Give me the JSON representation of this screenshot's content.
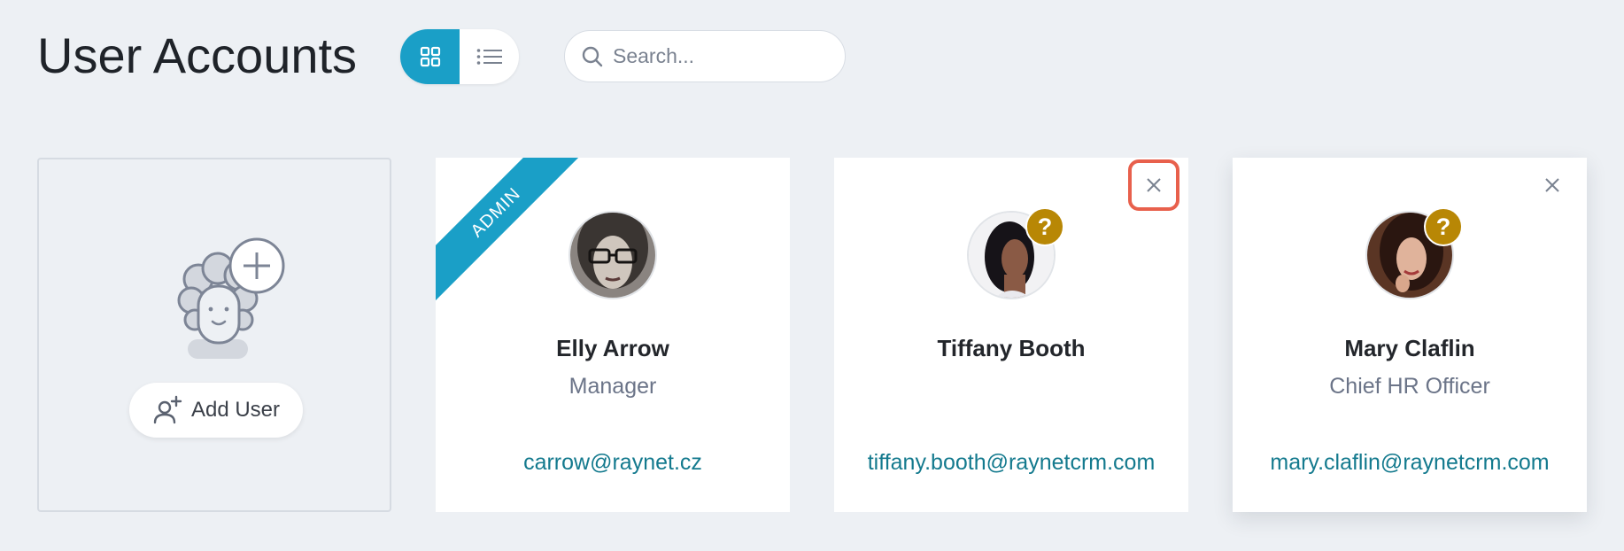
{
  "header": {
    "title": "User Accounts",
    "view_toggle": {
      "grid_icon": "grid-icon",
      "list_icon": "list-icon",
      "active": "grid"
    },
    "search": {
      "placeholder": "Search...",
      "value": "",
      "icon": "search-icon"
    }
  },
  "add_card": {
    "button_label": "Add User",
    "button_icon": "add-user-icon",
    "illustration": "add-user-illustration"
  },
  "users": [
    {
      "name": "Elly Arrow",
      "role": "Manager",
      "email": "carrow@raynet.cz",
      "badge": "ADMIN",
      "status_badge": "",
      "closable": false
    },
    {
      "name": "Tiffany Booth",
      "role": "",
      "email": "tiffany.booth@raynetcrm.com",
      "badge": "",
      "status_badge": "?",
      "closable": true,
      "close_highlighted": true
    },
    {
      "name": "Mary Claflin",
      "role": "Chief HR Officer",
      "email": "mary.claflin@raynetcrm.com",
      "badge": "",
      "status_badge": "?",
      "closable": true,
      "close_highlighted": false
    }
  ],
  "colors": {
    "accent": "#1a9fc7",
    "link": "#147a8e",
    "warning_badge": "#b88705",
    "highlight": "#e8604c",
    "background": "#edf0f4"
  }
}
